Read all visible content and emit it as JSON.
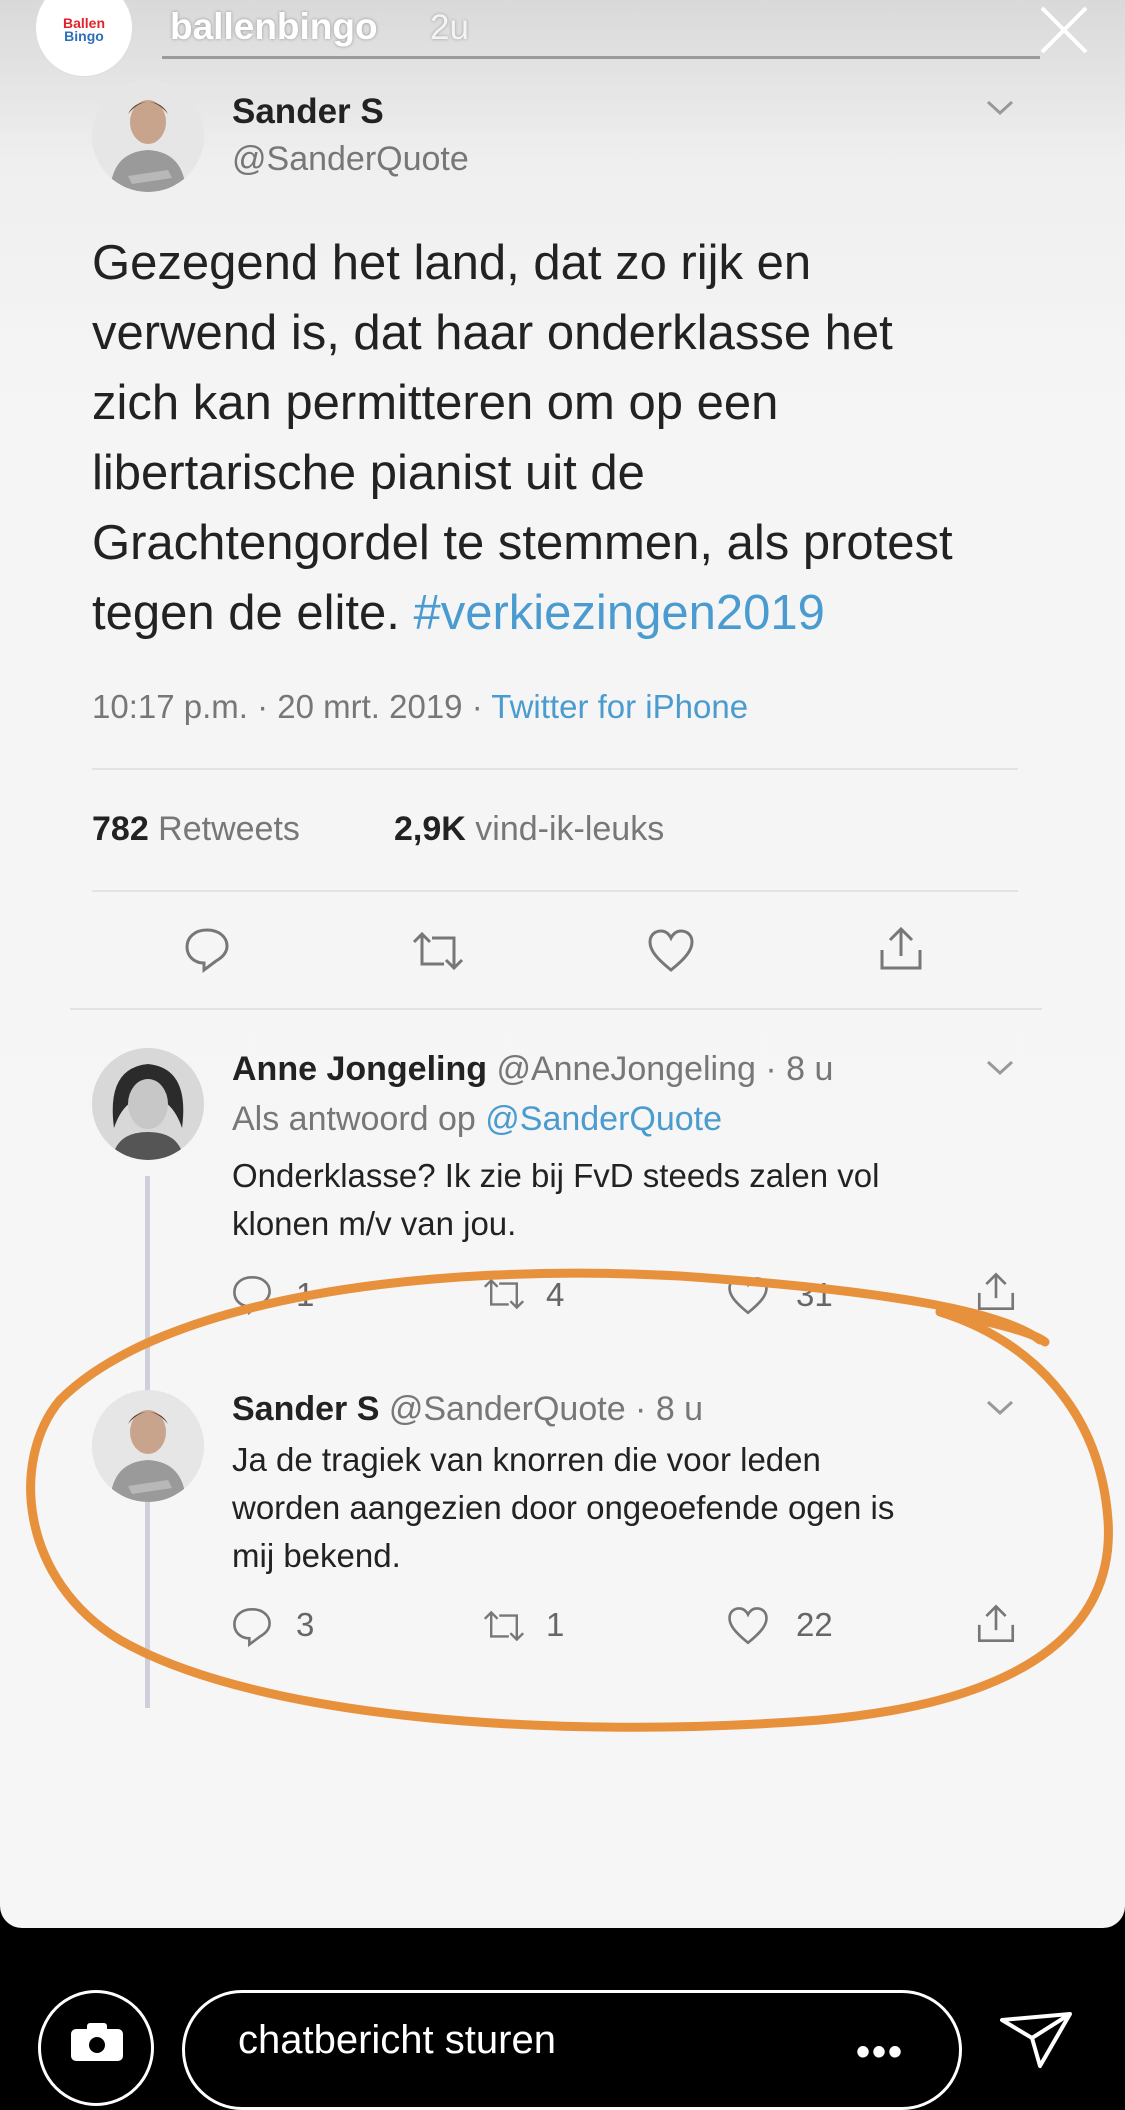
{
  "story": {
    "account": "ballenbingo",
    "time_ago": "2u",
    "avatar_logo": {
      "line1": "Ballen",
      "line2": "Bingo"
    }
  },
  "tweet": {
    "name": "Sander S",
    "handle": "@SanderQuote",
    "text_lines": [
      "Gezegend het land, dat zo rijk en",
      "verwend is, dat haar onderklasse het",
      "zich kan permitteren om op een",
      "libertarische pianist uit de",
      "Grachtengordel te stemmen, als protest",
      "tegen de elite. "
    ],
    "hashtag": "#verkiezingen2019",
    "timestamp": "10:17 p.m. · 20 mrt. 2019 · ",
    "source": "Twitter for iPhone",
    "retweets_count": "782",
    "retweets_label": " Retweets",
    "likes_count": "2,9K",
    "likes_label": " vind-ik-leuks"
  },
  "replies": [
    {
      "name": "Anne Jongeling",
      "handle": " @AnneJongeling · 8 u",
      "reply_to_prefix": "Als antwoord op ",
      "reply_to_handle": "@SanderQuote",
      "text_lines": [
        "Onderklasse? Ik zie bij FvD steeds zalen vol",
        "klonen m/v van jou."
      ],
      "replies": "1",
      "retweets": "4",
      "likes": "31"
    },
    {
      "name": "Sander S",
      "handle": " @SanderQuote · 8 u",
      "text_lines": [
        "Ja de tragiek van knorren die voor leden",
        "worden aangezien door ongeoefende ogen is",
        "mij bekend."
      ],
      "replies": "3",
      "retweets": "1",
      "likes": "22"
    }
  ],
  "annotation": {
    "color": "#e8913c",
    "shape": "hand-drawn-ellipse"
  },
  "bottom": {
    "placeholder": "chatbericht sturen",
    "more": "•••"
  },
  "colors": {
    "link": "#4a9bcf",
    "text": "#222222",
    "muted": "#777777"
  }
}
